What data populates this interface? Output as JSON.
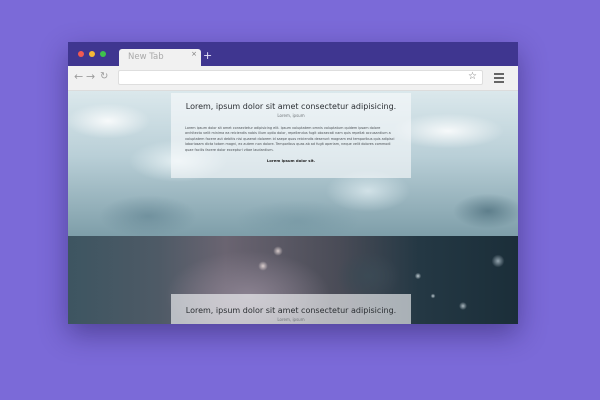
{
  "browser": {
    "tab_title": "New Tab",
    "tab_close_icon": "close-icon",
    "new_tab_label": "+",
    "address_value": "",
    "nav_icons": [
      "back-arrow-icon",
      "forward-arrow-icon",
      "reload-icon"
    ],
    "bookmark_icon": "star-icon",
    "menu_icon": "hamburger-menu-icon"
  },
  "page": {
    "card_top": {
      "title": "Lorem, ipsum dolor sit amet consectetur adipisicing.",
      "subtitle": "Lorem, ipsum",
      "body": "Lorem ipsum dolor sit amet consectetur adipisicing elit. Ipsum voluptatem omnis voluptatum quidem ipsam dolore architecto velit minima ea reiciendis nobis illum optio dolor, repellendus fugit obcaecati nam quis repellat accusantium a voluptatem facere aut debitis nisi quaerat dolorem id saepe quos reiciendis deserunt magnam est temporibus quis adipisci laboriosam dicta totam magni, ex autem non dolore. Temporibus quas ab ad fugit aperiam, neque velit dolores commodi quae facilis facere dolor excepturi vitae laudantium.",
      "strong": "Lorem ipsum dolor sit."
    },
    "card_bottom": {
      "title": "Lorem, ipsum dolor sit amet consectetur adipisicing.",
      "subtitle": "Lorem, ipsum"
    }
  },
  "colors": {
    "background": "#7b6ad8",
    "titlebar": "#3f3690",
    "traffic_red": "#f25a52",
    "traffic_yellow": "#f6b936",
    "traffic_green": "#3ec24c"
  }
}
